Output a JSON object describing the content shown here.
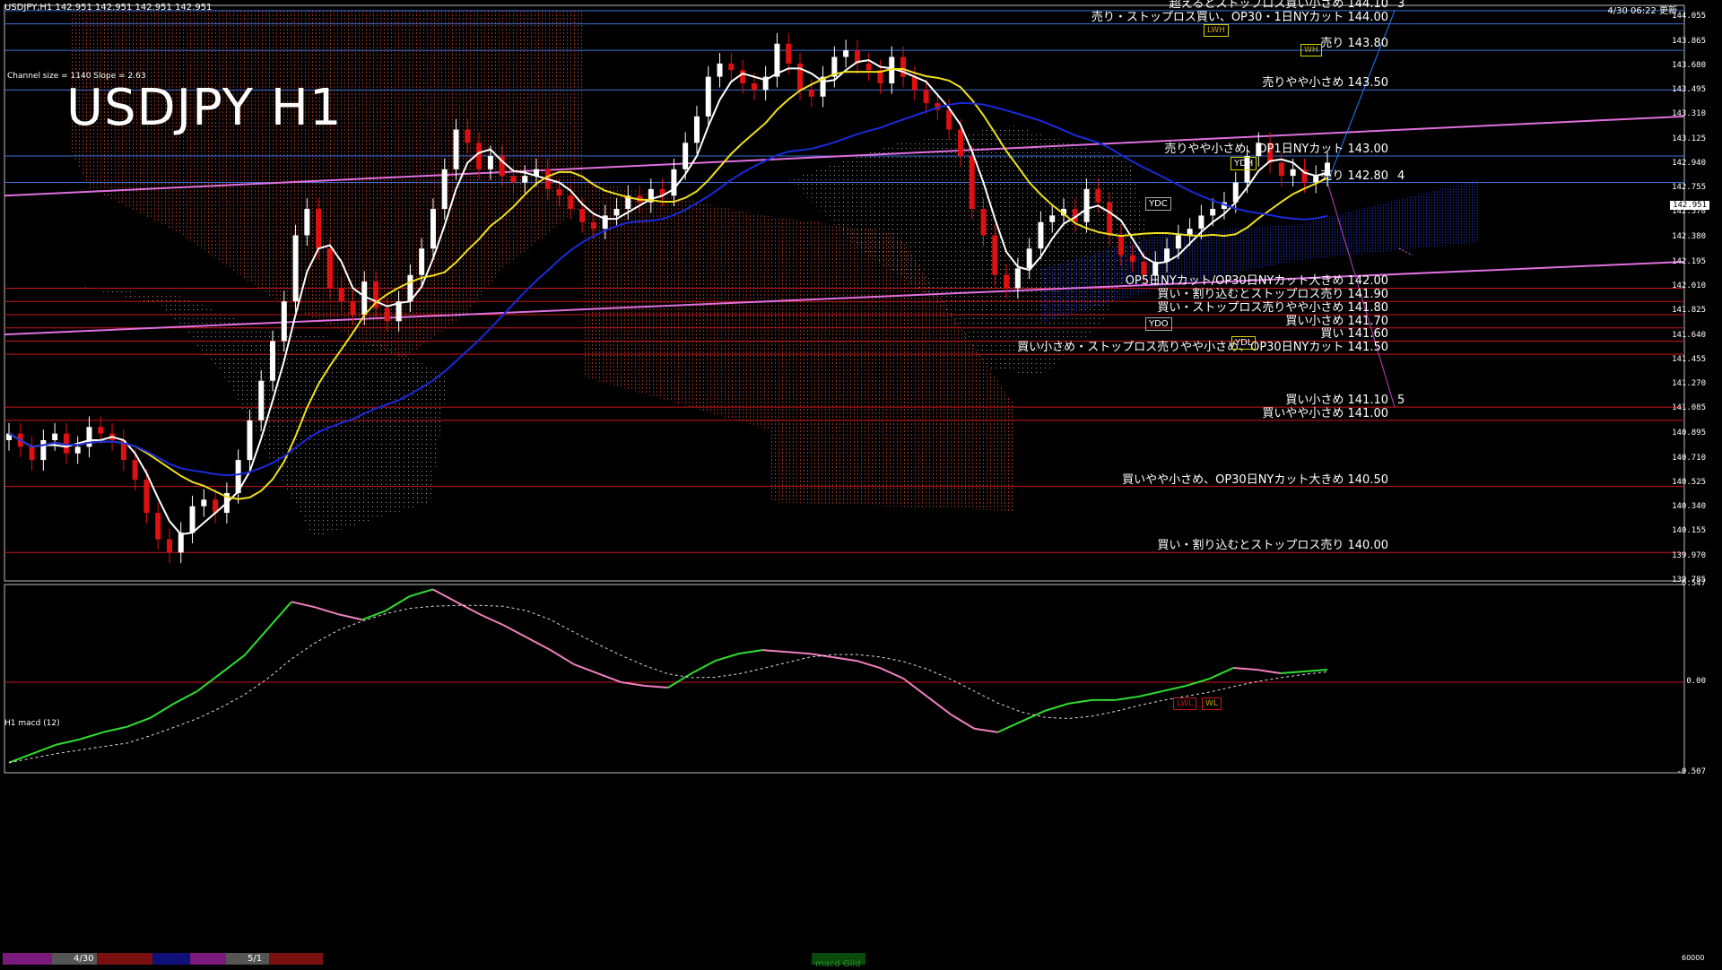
{
  "header": {
    "symbol_info": "USDJPY,H1  142.951 142.951 142.951 142.951",
    "channel_info": "Channel size = 1140 Slope = 2.63",
    "big_title": "USDJPY H1",
    "timestamp": "4/30 06:22 更新",
    "macd_title": "H1  macd (12)",
    "current_price": "142.951"
  },
  "levels": [
    {
      "text": "超えるとストップロス買い小さめ 144.10",
      "value": 144.1,
      "color": "#3b6fd9",
      "mark": "3"
    },
    {
      "text": "売り・ストップロス買い、OP30・1日NYカット 144.00",
      "value": 144.0,
      "color": "#3b6fd9"
    },
    {
      "text": "売り 143.80",
      "value": 143.8,
      "color": "#3b6fd9"
    },
    {
      "text": "売りやや小さめ 143.50",
      "value": 143.5,
      "color": "#3b6fd9"
    },
    {
      "text": "売りやや小さめ、OP1日NYカット 143.00",
      "value": 143.0,
      "color": "#3b6fd9"
    },
    {
      "text": "売り 142.80",
      "value": 142.8,
      "color": "#3b6fd9",
      "mark": "4"
    },
    {
      "text": "OP5日NYカット/OP30日NYカット大きめ 142.00",
      "value": 142.0,
      "color": "#c81818"
    },
    {
      "text": "買い・割り込むとストップロス売り 141.90",
      "value": 141.9,
      "color": "#c81818"
    },
    {
      "text": "買い・ストップロス売りやや小さめ 141.80",
      "value": 141.8,
      "color": "#c81818"
    },
    {
      "text": "買い小さめ 141.70",
      "value": 141.7,
      "color": "#c81818"
    },
    {
      "text": "買い 141.60",
      "value": 141.6,
      "color": "#c81818"
    },
    {
      "text": "買い小さめ・ストップロス売りやや小さめ、OP30日NYカット 141.50",
      "value": 141.5,
      "color": "#c81818"
    },
    {
      "text": "買い小さめ 141.10",
      "value": 141.1,
      "color": "#c81818",
      "mark": "5"
    },
    {
      "text": "買いやや小さめ 141.00",
      "value": 141.0,
      "color": "#c81818"
    },
    {
      "text": "買いやや小さめ、OP30日NYカット大きめ 140.50",
      "value": 140.5,
      "color": "#c81818"
    },
    {
      "text": "買い・割り込むとストップロス売り 140.00",
      "value": 140.0,
      "color": "#c81818"
    }
  ],
  "yaxis_ticks": [
    "144.055",
    "143.865",
    "143.680",
    "143.495",
    "143.310",
    "143.125",
    "142.940",
    "142.755",
    "142.570",
    "142.380",
    "142.195",
    "142.010",
    "141.825",
    "141.640",
    "141.455",
    "141.270",
    "141.085",
    "140.895",
    "140.710",
    "140.525",
    "140.340",
    "140.155",
    "139.970",
    "139.785"
  ],
  "macd_ticks": [
    "0.547",
    "0.00",
    "-0.507"
  ],
  "tags": {
    "ydh": "YDH",
    "ydc": "YDC",
    "ydo": "YDO",
    "ydl": "YDL",
    "lwh": "LWH",
    "wh": "WH",
    "lwl": "LWL",
    "wl": "WL"
  },
  "timebar": {
    "date1": "4/30",
    "date2": "5/1",
    "macd_btn": "macd Gild",
    "volume": "60000"
  },
  "colors": {
    "bull": "#ffffff",
    "bear": "#e01010",
    "sma_fast": "#ffffff",
    "sma_mid": "#f0e020",
    "sma_slow": "#1a2adc",
    "macd_up": "#30dd30",
    "macd_down": "#f080c0"
  },
  "chart_data": {
    "type": "candlestick",
    "title": "USDJPY H1",
    "ylim": [
      139.785,
      144.14
    ],
    "close_series": [
      140.9,
      140.8,
      140.7,
      140.85,
      140.9,
      140.75,
      140.8,
      140.95,
      140.9,
      140.85,
      140.7,
      140.55,
      140.3,
      140.1,
      140.0,
      140.15,
      140.35,
      140.4,
      140.3,
      140.45,
      140.7,
      141.0,
      141.3,
      141.6,
      141.9,
      142.4,
      142.6,
      142.3,
      142.0,
      141.9,
      141.8,
      142.05,
      141.85,
      141.75,
      141.9,
      142.1,
      142.3,
      142.6,
      142.9,
      143.2,
      143.1,
      142.9,
      143.0,
      142.85,
      142.8,
      142.85,
      142.9,
      142.75,
      142.7,
      142.6,
      142.5,
      142.45,
      142.55,
      142.6,
      142.7,
      142.65,
      142.75,
      142.7,
      142.9,
      143.1,
      143.3,
      143.6,
      143.7,
      143.65,
      143.55,
      143.5,
      143.6,
      143.85,
      143.7,
      143.5,
      143.45,
      143.6,
      143.75,
      143.8,
      143.7,
      143.65,
      143.55,
      143.75,
      143.6,
      143.5,
      143.4,
      143.35,
      143.2,
      143.0,
      142.6,
      142.4,
      142.1,
      142.0,
      142.15,
      142.3,
      142.5,
      142.55,
      142.6,
      142.5,
      142.75,
      142.65,
      142.4,
      142.25,
      142.2,
      142.1,
      142.2,
      142.3,
      142.4,
      142.45,
      142.55,
      142.6,
      142.65,
      142.8,
      143.0,
      143.1,
      142.95,
      142.85,
      142.9,
      142.8,
      142.85,
      142.95
    ],
    "macd_series": [
      -0.45,
      -0.4,
      -0.35,
      -0.32,
      -0.28,
      -0.25,
      -0.2,
      -0.12,
      -0.05,
      0.05,
      0.15,
      0.3,
      0.45,
      0.42,
      0.38,
      0.35,
      0.4,
      0.48,
      0.52,
      0.45,
      0.38,
      0.32,
      0.25,
      0.18,
      0.1,
      0.05,
      0.0,
      -0.02,
      -0.03,
      0.05,
      0.12,
      0.16,
      0.18,
      0.17,
      0.16,
      0.14,
      0.12,
      0.08,
      0.02,
      -0.08,
      -0.18,
      -0.26,
      -0.28,
      -0.22,
      -0.16,
      -0.12,
      -0.1,
      -0.1,
      -0.08,
      -0.05,
      -0.02,
      0.02,
      0.08,
      0.07,
      0.05,
      0.06,
      0.07
    ],
    "macd_ylim": [
      -0.507,
      0.547
    ]
  }
}
